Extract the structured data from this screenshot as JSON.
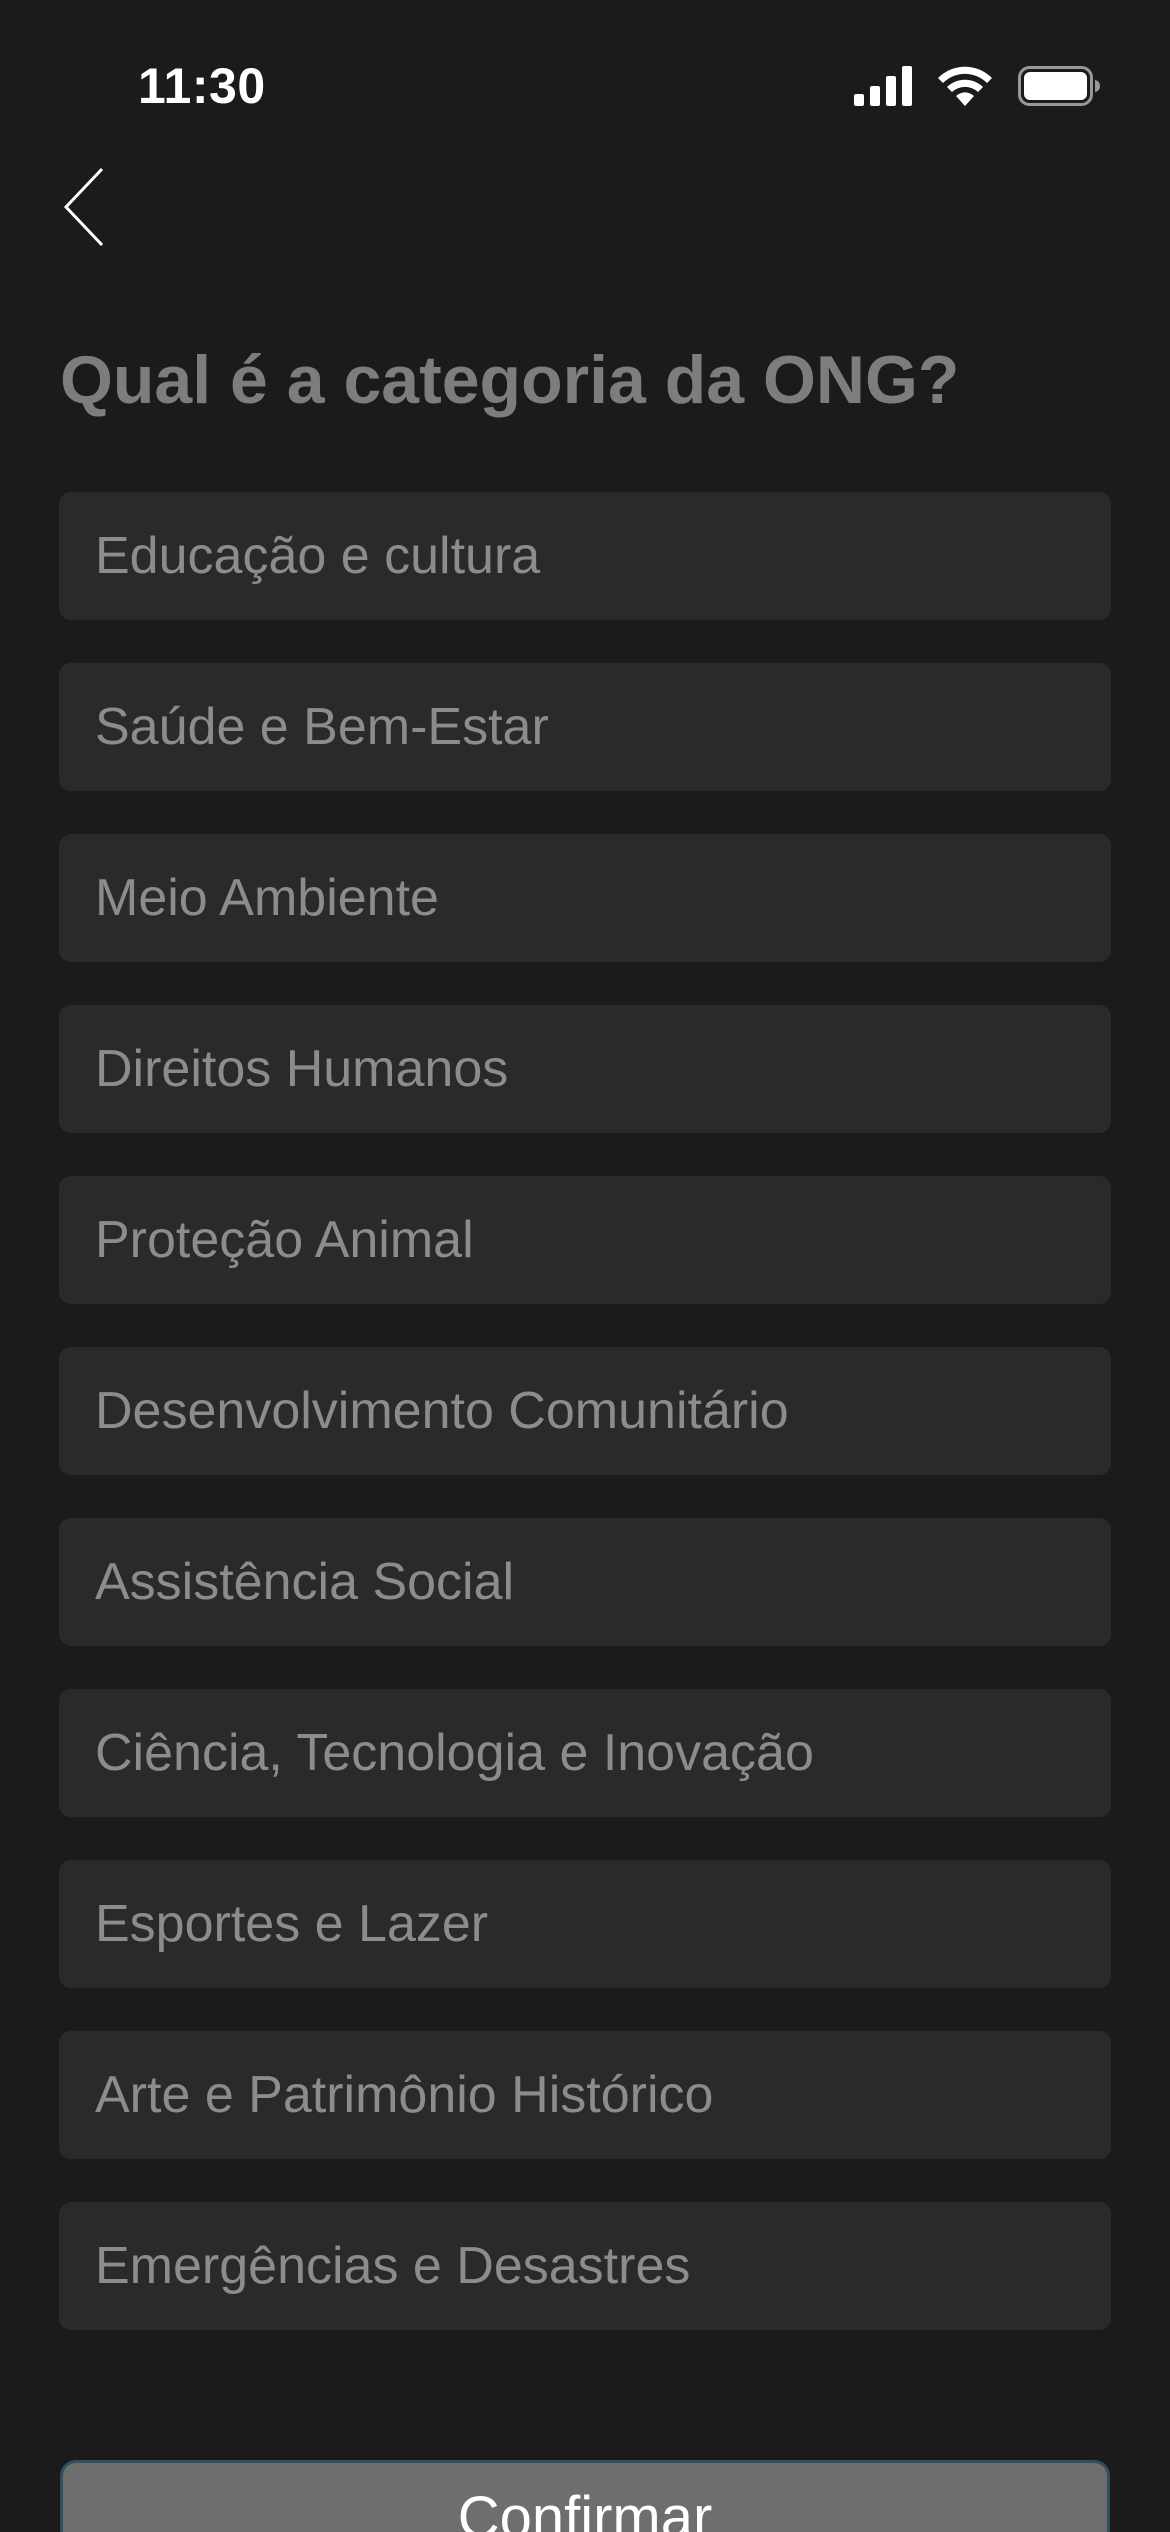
{
  "status_bar": {
    "time": "11:30",
    "icons": [
      "signal-icon",
      "wifi-icon",
      "battery-icon"
    ]
  },
  "header": {
    "back_icon": "chevron-left-icon",
    "title": "Qual é a categoria da ONG?"
  },
  "options": [
    {
      "label": "Educação e cultura"
    },
    {
      "label": "Saúde e Bem-Estar"
    },
    {
      "label": "Meio Ambiente"
    },
    {
      "label": "Direitos Humanos"
    },
    {
      "label": "Proteção Animal"
    },
    {
      "label": "Desenvolvimento Comunitário"
    },
    {
      "label": "Assistência Social"
    },
    {
      "label": "Ciência, Tecnologia e Inovação"
    },
    {
      "label": "Esportes e Lazer"
    },
    {
      "label": "Arte e Patrimônio Histórico"
    },
    {
      "label": "Emergências e Desastres"
    }
  ],
  "confirm": {
    "label": "Confirmar"
  },
  "colors": {
    "background": "#1b1b1b",
    "option_background": "#2a2a2a",
    "option_text": "#8c8c8c",
    "title_text": "#7d7d7d",
    "confirm_background": "#6e6e6e",
    "confirm_border": "#2f4f62"
  }
}
